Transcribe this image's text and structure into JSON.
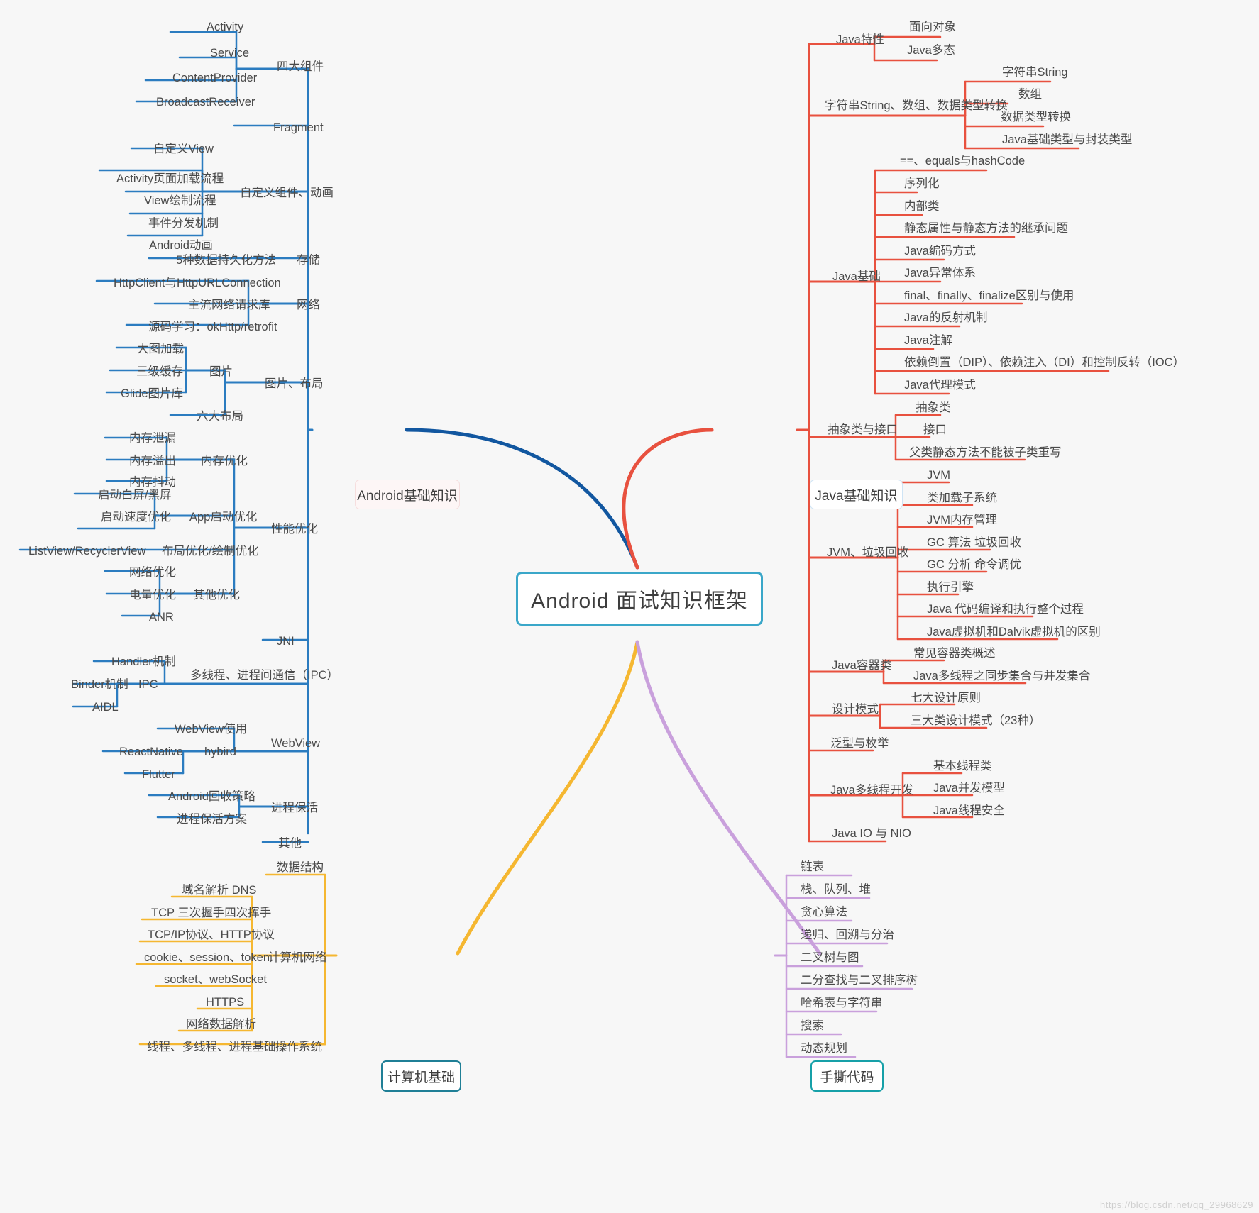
{
  "root": {
    "label": "Android 面试知识框架",
    "border_color": "#3aa7c9"
  },
  "watermark": "https://blog.csdn.net/qq_29968629",
  "branches": [
    {
      "id": "android",
      "label": "Android基础知识",
      "color": "#1257a0",
      "groups": [
        {
          "label": "四大组件",
          "children": [
            "Activity",
            "Service",
            "ContentProvider",
            "BroadcastReceiver"
          ]
        },
        {
          "label": "Fragment",
          "children": []
        },
        {
          "label": "自定义组件、动画",
          "children": [
            "自定义View",
            "Activity页面加载流程",
            "View绘制流程",
            "事件分发机制",
            "Android动画"
          ]
        },
        {
          "label": "存储",
          "children": [
            "5种数据持久化方法"
          ]
        },
        {
          "label": "网络",
          "children": [
            "HttpClient与HttpURLConnection",
            "主流网络请求库",
            "源码学习：okHttp/retrofit"
          ]
        },
        {
          "label": "图片、布局",
          "children": [
            "图片",
            "六大布局"
          ],
          "subgroups": [
            {
              "label": "图片",
              "children": [
                "大图加载",
                "三级缓存",
                "Glide图片库"
              ]
            }
          ]
        },
        {
          "label": "性能优化",
          "children": [],
          "subgroups": [
            {
              "label": "内存优化",
              "children": [
                "内存泄漏",
                "内存溢出",
                "内存抖动"
              ]
            },
            {
              "label": "App启动优化",
              "children": [
                "启动白屏/黑屏",
                "启动速度优化"
              ]
            },
            {
              "label": "布局优化/绘制优化",
              "children": [
                "ListView/RecyclerView"
              ]
            },
            {
              "label": "其他优化",
              "children": [
                "网络优化",
                "电量优化",
                "ANR"
              ]
            }
          ]
        },
        {
          "label": "JNI",
          "children": []
        },
        {
          "label": "多线程、进程间通信（IPC）",
          "children": [
            "Handler机制"
          ],
          "subgroups": [
            {
              "label": "IPC",
              "children": [
                "Binder机制",
                "AIDL"
              ]
            }
          ]
        },
        {
          "label": "WebView",
          "children": [
            "WebView使用"
          ],
          "subgroups": [
            {
              "label": "hybird",
              "children": [
                "ReactNative",
                "Flutter"
              ]
            }
          ]
        },
        {
          "label": "进程保活",
          "children": [
            "Android回收策略",
            "进程保活方案"
          ]
        },
        {
          "label": "其他",
          "children": []
        }
      ]
    },
    {
      "id": "java",
      "label": "Java基础知识",
      "color": "#e8513f",
      "groups": [
        {
          "label": "Java特性",
          "children": [
            "面向对象",
            "Java多态"
          ]
        },
        {
          "label": "字符串String、数组、数据类型转换",
          "children": [
            "字符串String",
            "数组",
            "数据类型转换",
            "Java基础类型与封装类型"
          ]
        },
        {
          "label": "Java基础",
          "children": [
            "==、equals与hashCode",
            "序列化",
            "内部类",
            "静态属性与静态方法的继承问题",
            "Java编码方式",
            "Java异常体系",
            "final、finally、finalize区别与使用",
            "Java的反射机制",
            "Java注解",
            "依赖倒置（DIP）、依赖注入（DI）和控制反转（IOC）",
            "Java代理模式"
          ]
        },
        {
          "label": "抽象类与接口",
          "children": [
            "抽象类",
            "接口",
            "父类静态方法不能被子类重写"
          ]
        },
        {
          "label": "JVM、垃圾回收",
          "children": [
            "JVM",
            "类加载子系统",
            "JVM内存管理",
            "GC 算法 垃圾回收",
            "GC 分析 命令调优",
            "执行引擎",
            "Java 代码编译和执行整个过程",
            "Java虚拟机和Dalvik虚拟机的区别"
          ]
        },
        {
          "label": "Java容器类",
          "children": [
            "常见容器类概述",
            "Java多线程之同步集合与并发集合"
          ]
        },
        {
          "label": "设计模式",
          "children": [
            "七大设计原则",
            "三大类设计模式（23种）"
          ]
        },
        {
          "label": "泛型与枚举",
          "children": []
        },
        {
          "label": "Java多线程开发",
          "children": [
            "基本线程类",
            "Java并发模型",
            "Java线程安全"
          ]
        },
        {
          "label": "Java IO 与 NIO",
          "children": []
        }
      ]
    },
    {
      "id": "cs",
      "label": "计算机基础",
      "color": "#f5b731",
      "groups": [
        {
          "label": "数据结构",
          "children": []
        },
        {
          "label": "计算机网络",
          "children": [
            "域名解析 DNS",
            "TCP 三次握手四次挥手",
            "TCP/IP协议、HTTP协议",
            "cookie、session、token",
            "socket、webSocket",
            "HTTPS",
            "网络数据解析"
          ]
        },
        {
          "label": "操作系统",
          "children": [
            "线程、多线程、进程基础"
          ]
        }
      ]
    },
    {
      "id": "code",
      "label": "手撕代码",
      "color": "#c9a0dc",
      "groups": [
        {
          "label": "链表",
          "children": []
        },
        {
          "label": "栈、队列、堆",
          "children": []
        },
        {
          "label": "贪心算法",
          "children": []
        },
        {
          "label": "递归、回溯与分治",
          "children": []
        },
        {
          "label": "二叉树与图",
          "children": []
        },
        {
          "label": "二分查找与二叉排序树",
          "children": []
        },
        {
          "label": "哈希表与字符串",
          "children": []
        },
        {
          "label": "搜索",
          "children": []
        },
        {
          "label": "动态规划",
          "children": []
        }
      ]
    }
  ],
  "labels": {
    "activity": "Activity",
    "service": "Service",
    "content_provider": "ContentProvider",
    "broadcast_receiver": "BroadcastReceiver",
    "four_components": "四大组件",
    "fragment": "Fragment",
    "custom_view": "自定义View",
    "activity_load": "Activity页面加载流程",
    "view_draw": "View绘制流程",
    "event_dispatch": "事件分发机制",
    "android_anim": "Android动画",
    "custom_component": "自定义组件、动画",
    "persistence": "5种数据持久化方法",
    "storage": "存储",
    "httpclient": "HttpClient与HttpURLConnection",
    "net_lib": "主流网络请求库",
    "source_study": "源码学习：okHttp/retrofit",
    "network": "网络",
    "big_image": "大图加载",
    "three_cache": "三级缓存",
    "glide": "Glide图片库",
    "image": "图片",
    "six_layout": "六大布局",
    "image_layout": "图片、布局",
    "mem_leak": "内存泄漏",
    "mem_overflow": "内存溢出",
    "mem_churn": "内存抖动",
    "mem_opt": "内存优化",
    "start_white": "启动白屏/黑屏",
    "start_speed": "启动速度优化",
    "app_start_opt": "App启动优化",
    "listview": "ListView/RecyclerView",
    "layout_opt": "布局优化/绘制优化",
    "net_opt": "网络优化",
    "power_opt": "电量优化",
    "anr": "ANR",
    "other_opt": "其他优化",
    "perf_opt": "性能优化",
    "jni": "JNI",
    "handler": "Handler机制",
    "binder": "Binder机制",
    "aidl": "AIDL",
    "ipc": "IPC",
    "multithread_ipc": "多线程、进程间通信（IPC）",
    "webview_use": "WebView使用",
    "reactnative": "ReactNative",
    "flutter": "Flutter",
    "hybird": "hybird",
    "webview": "WebView",
    "recycle_policy": "Android回收策略",
    "keep_alive_plan": "进程保活方案",
    "keep_alive": "进程保活",
    "other": "其他",
    "oop": "面向对象",
    "polymorphism": "Java多态",
    "java_feature": "Java特性",
    "str_string": "字符串String",
    "array": "数组",
    "type_convert": "数据类型转换",
    "base_wrap": "Java基础类型与封装类型",
    "string_array_convert": "字符串String、数组、数据类型转换",
    "equals_hash": "==、equals与hashCode",
    "serialize": "序列化",
    "inner_class": "内部类",
    "static_inherit": "静态属性与静态方法的继承问题",
    "encoding": "Java编码方式",
    "exception": "Java异常体系",
    "final_finally": "final、finally、finalize区别与使用",
    "reflect": "Java的反射机制",
    "annotation": "Java注解",
    "dip_di_ioc": "依赖倒置（DIP）、依赖注入（DI）和控制反转（IOC）",
    "proxy": "Java代理模式",
    "java_base": "Java基础",
    "abstract_class": "抽象类",
    "interface": "接口",
    "static_override": "父类静态方法不能被子类重写",
    "abstract_interface": "抽象类与接口",
    "jvm": "JVM",
    "class_loader": "类加载子系统",
    "jvm_mem": "JVM内存管理",
    "gc_algo": "GC 算法 垃圾回收",
    "gc_analysis": "GC 分析 命令调优",
    "exec_engine": "执行引擎",
    "compile_exec": "Java 代码编译和执行整个过程",
    "jvm_dalvik": "Java虚拟机和Dalvik虚拟机的区别",
    "jvm_gc": "JVM、垃圾回收",
    "container_overview": "常见容器类概述",
    "sync_concurrent": "Java多线程之同步集合与并发集合",
    "java_container": "Java容器类",
    "seven_principle": "七大设计原则",
    "three_patterns": "三大类设计模式（23种）",
    "design_pattern": "设计模式",
    "generic_enum": "泛型与枚举",
    "basic_thread": "基本线程类",
    "concurrent_model": "Java并发模型",
    "thread_safe": "Java线程安全",
    "java_multithread": "Java多线程开发",
    "java_io_nio": "Java IO 与 NIO",
    "data_structure": "数据结构",
    "dns": "域名解析 DNS",
    "tcp_handshake": "TCP 三次握手四次挥手",
    "tcpip_http": "TCP/IP协议、HTTP协议",
    "cookie_session": "cookie、session、token",
    "socket_ws": "socket、webSocket",
    "https": "HTTPS",
    "net_parse": "网络数据解析",
    "computer_network": "计算机网络",
    "thread_process": "线程、多线程、进程基础",
    "os": "操作系统",
    "linked_list": "链表",
    "stack_queue_heap": "栈、队列、堆",
    "greedy": "贪心算法",
    "recursion": "递归、回溯与分治",
    "binary_tree_graph": "二叉树与图",
    "binary_search": "二分查找与二叉排序树",
    "hash_string": "哈希表与字符串",
    "search": "搜索",
    "dp": "动态规划"
  }
}
